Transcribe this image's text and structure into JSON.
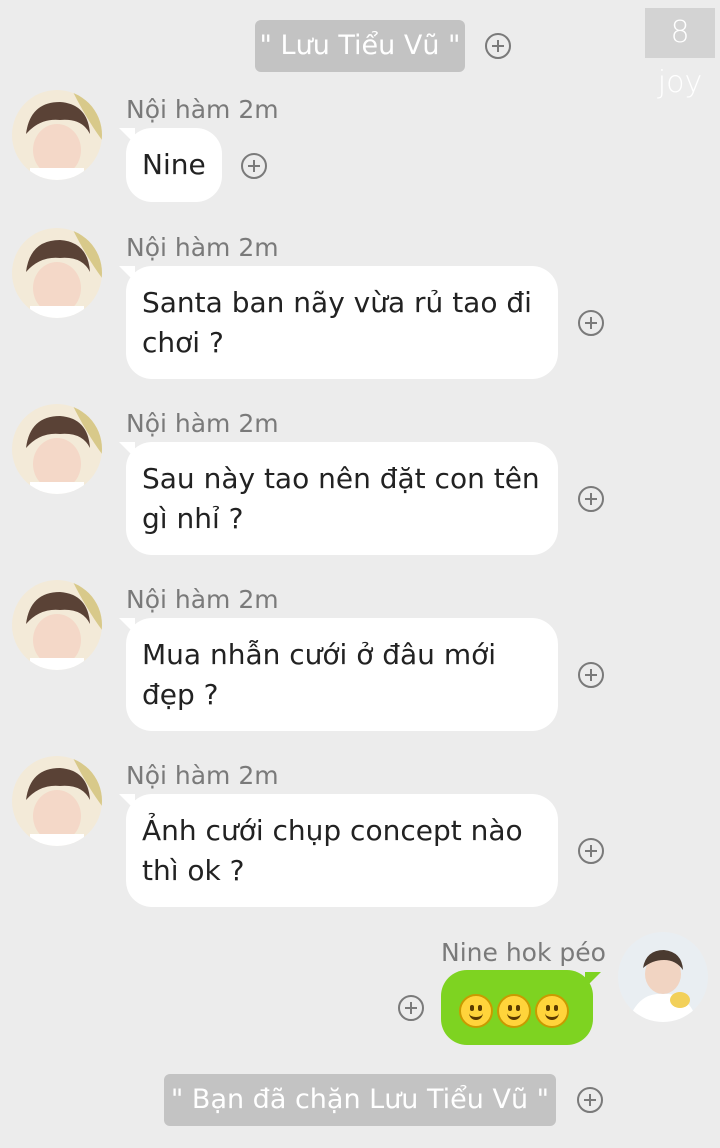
{
  "watermark": "8 joy",
  "header_pill": "\" Lưu Tiểu Vũ \"",
  "messages": [
    {
      "sender": "Nội hàm 2m",
      "text": "Nine"
    },
    {
      "sender": "Nội hàm 2m",
      "text": "Santa ban nãy vừa rủ tao đi chơi ?"
    },
    {
      "sender": "Nội hàm 2m",
      "text": "Sau này tao nên đặt con tên gì nhỉ ?"
    },
    {
      "sender": "Nội hàm 2m",
      "text": "Mua nhẫn cưới ở đâu mới đẹp ?"
    },
    {
      "sender": "Nội hàm 2m",
      "text": "Ảnh cưới chụp concept nào thì ok ?"
    }
  ],
  "reply": {
    "sender": "Nine hok péo",
    "emoji": [
      "slightly-smiling-face",
      "slightly-smiling-face",
      "slightly-smiling-face"
    ]
  },
  "footer_pill": "\" Bạn đã chặn Lưu Tiểu Vũ \"",
  "colors": {
    "background": "#ececec",
    "pill": "#c3c3c3",
    "bubble_left": "#ffffff",
    "bubble_right": "#7ed321"
  }
}
